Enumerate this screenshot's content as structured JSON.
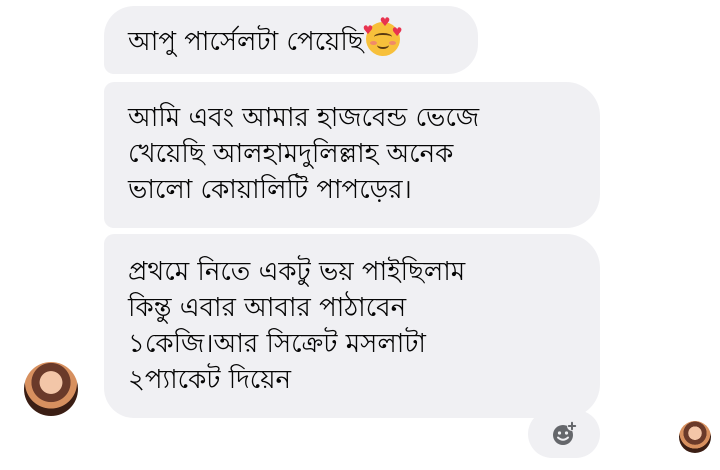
{
  "messages": [
    {
      "id": "msg-1",
      "lines": [
        "আপু পার্সেলটা পেয়েছি"
      ],
      "emoji": "smiling-face-with-hearts"
    },
    {
      "id": "msg-2",
      "lines": [
        "আমি এবং আমার হাজবেন্ড ভেজে",
        "খেয়েছি আলহামদুলিল্লাহ অনেক",
        "ভালো কোয়ালিটি পাপড়ের।"
      ]
    },
    {
      "id": "msg-3",
      "lines": [
        "প্রথমে নিতে একটু ভয় পাইছিলাম",
        "কিন্তু এবার আবার পাঠাবেন",
        "১কেজি।আর সিক্রেট মসলাটা",
        "২প্যাকেট দিয়েন"
      ]
    }
  ],
  "icons": {
    "react": "add-reaction-icon",
    "sender_avatar": "sender-avatar",
    "read_receipt": "read-receipt-avatar"
  },
  "colors": {
    "bubble": "#f0f0f3",
    "text": "#050505",
    "background": "#ffffff"
  }
}
